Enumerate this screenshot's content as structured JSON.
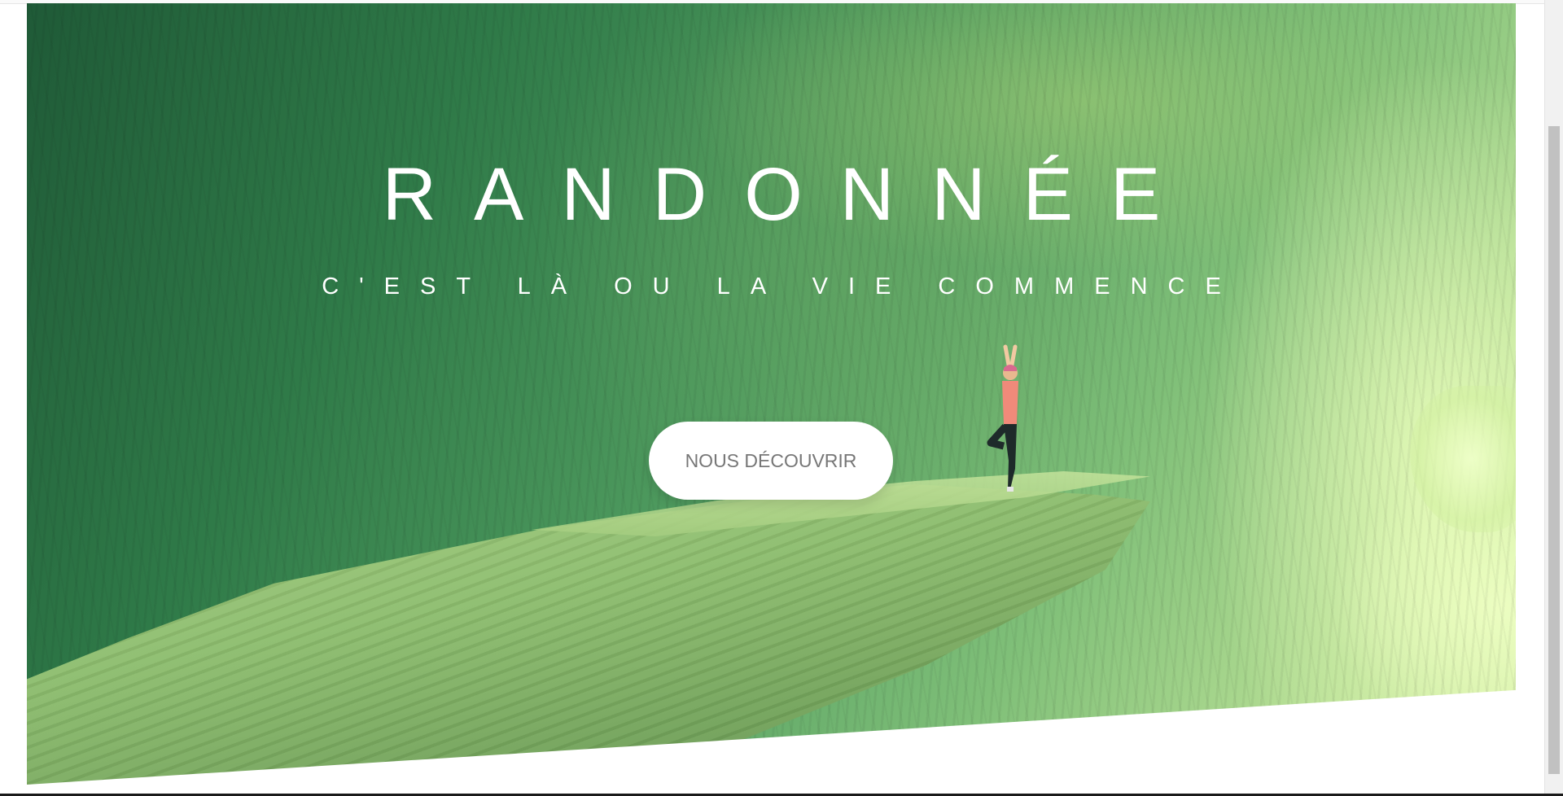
{
  "hero": {
    "title": "RANDONNÉE",
    "subtitle": "C'EST LÀ OU LA VIE COMMENCE",
    "cta_label": "NOUS DÉCOUVRIR",
    "background_description_colors": {
      "overlay_dark": "#1f5a37",
      "overlay_light": "#d7f0a8"
    }
  },
  "colors": {
    "title_text": "#ffffff",
    "button_bg": "#ffffff",
    "button_text": "#777777",
    "page_bg": "#ffffff"
  }
}
